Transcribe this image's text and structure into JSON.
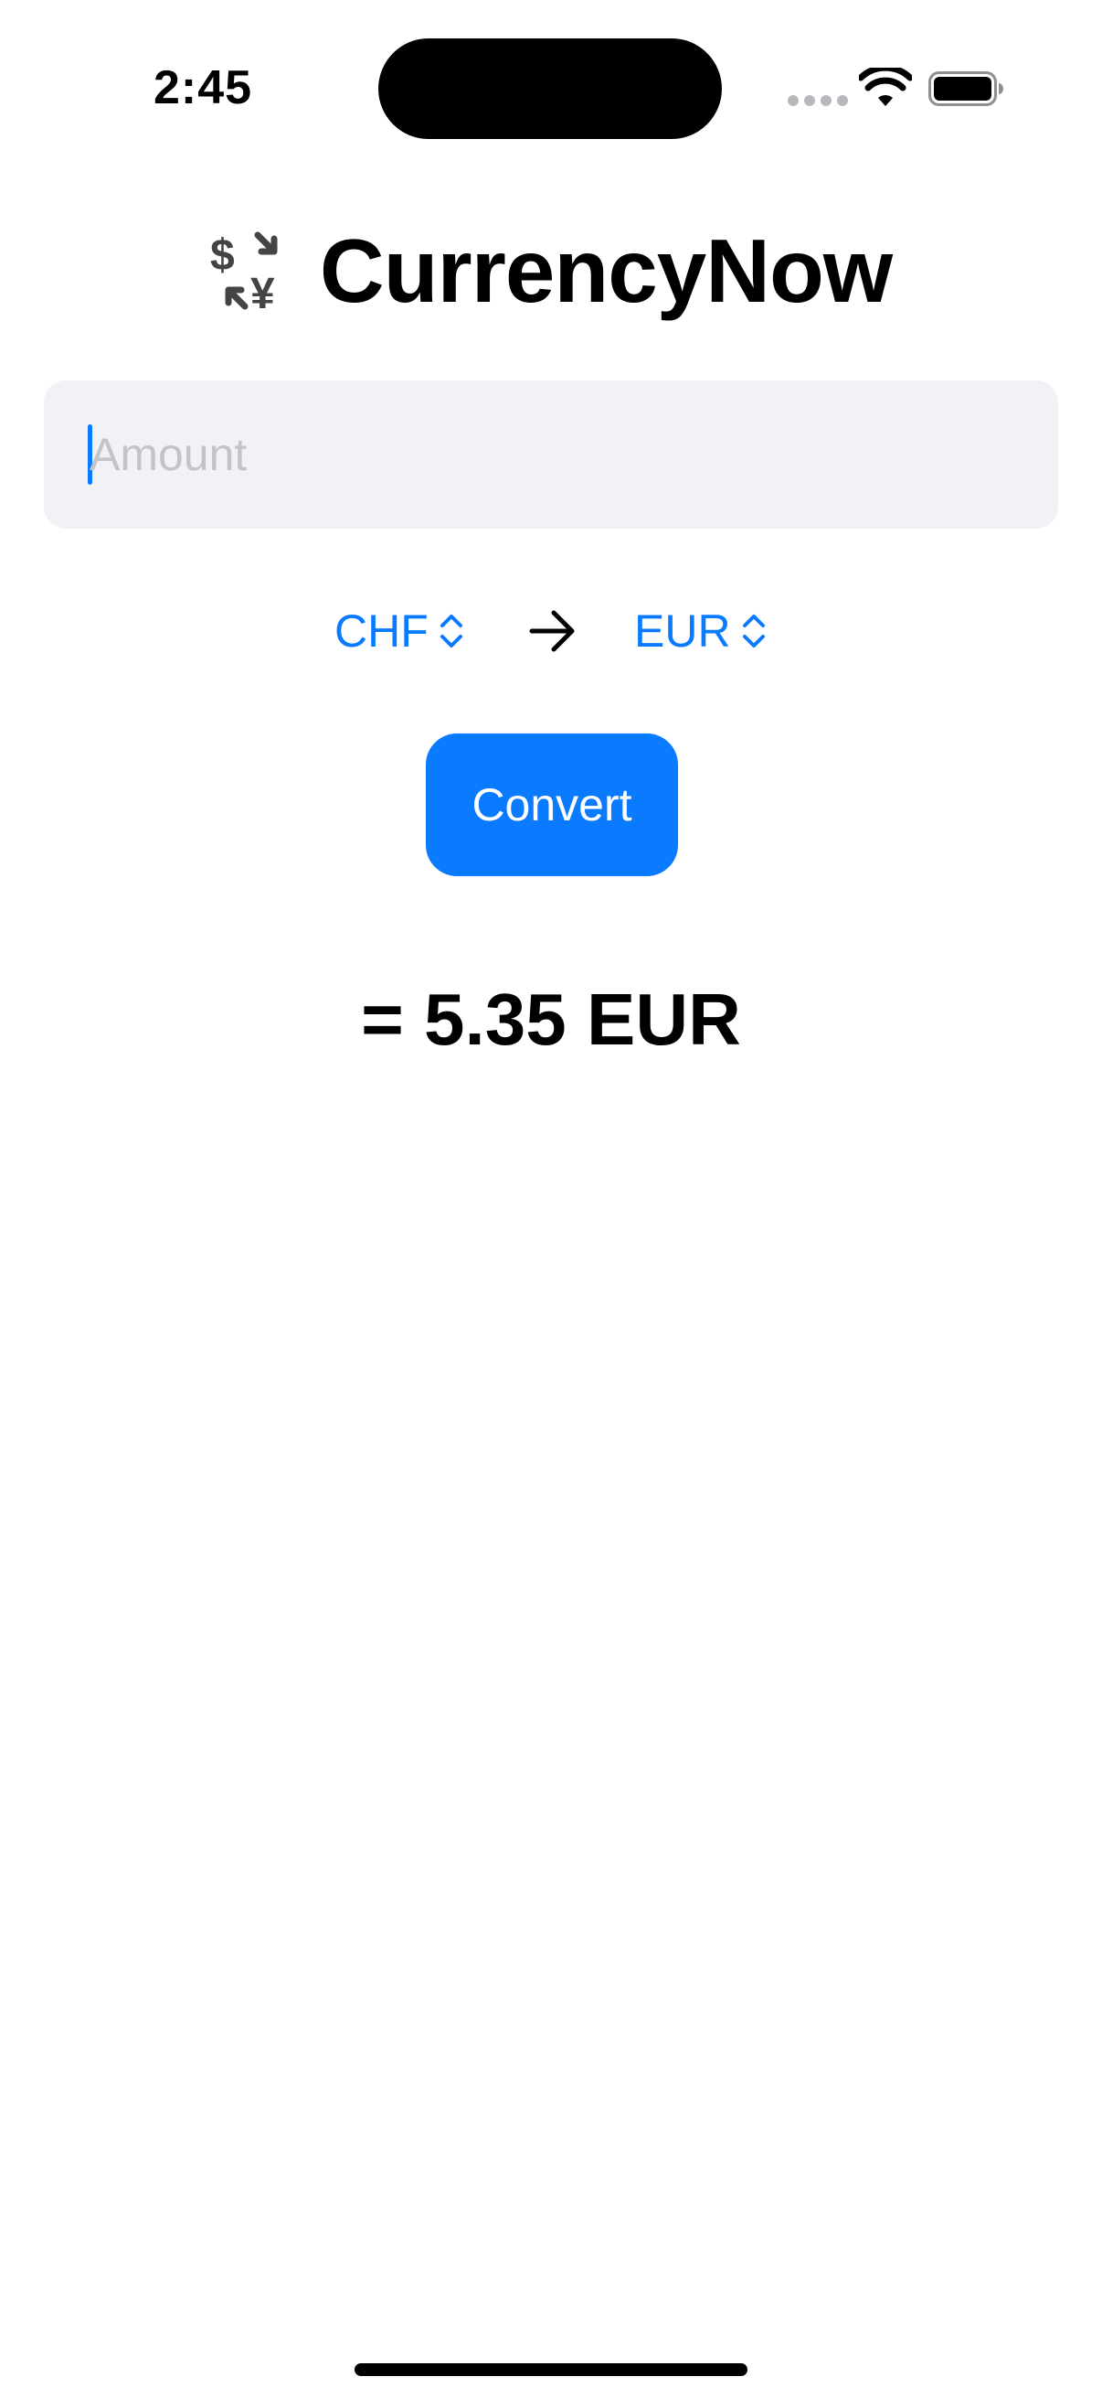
{
  "status_bar": {
    "time": "2:45"
  },
  "app": {
    "title": "CurrencyNow",
    "title_icon": "currency-exchange-icon"
  },
  "amount_field": {
    "value": "",
    "placeholder": "Amount"
  },
  "pickers": {
    "from": "CHF",
    "to": "EUR",
    "arrow_icon": "arrow-right-icon",
    "chevron_icon": "chevron-up-down-icon"
  },
  "convert_button": {
    "label": "Convert"
  },
  "result": {
    "text": "= 5.35 EUR"
  },
  "colors": {
    "accent": "#0a7aff",
    "field_background": "#f1f1f6",
    "placeholder": "#c3c3c8",
    "text": "#000000",
    "background": "#ffffff"
  }
}
